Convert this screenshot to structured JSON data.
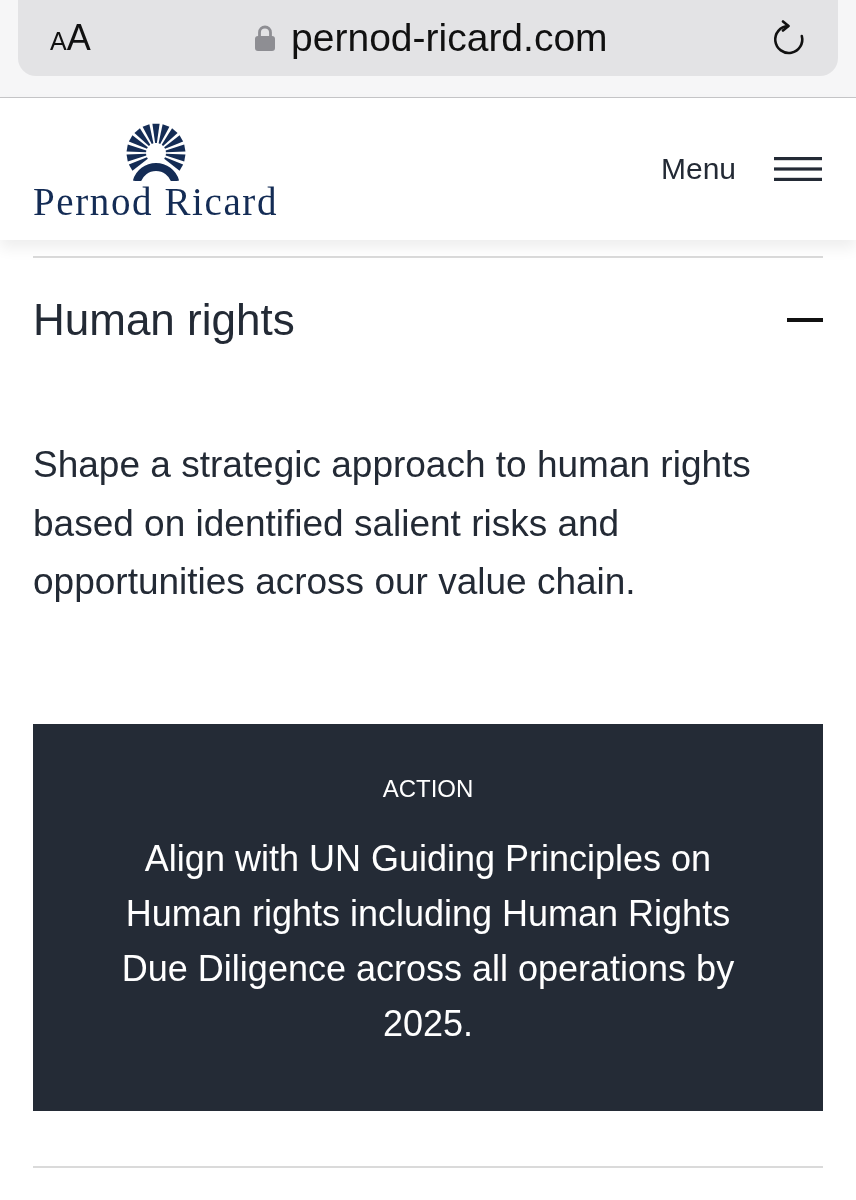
{
  "browser_bar": {
    "text_size_button": "AA",
    "secure": true,
    "url": "pernod-ricard.com"
  },
  "header": {
    "logo_text": "Pernod Ricard",
    "menu_label": "Menu"
  },
  "accordion": {
    "title": "Human rights",
    "expanded": true,
    "description": "Shape a strategic approach to human rights based on identified salient risks and opportunities across our value chain.",
    "action": {
      "label": "ACTION",
      "text": "Align with UN Guiding Principles on Human rights including Human Rights Due Diligence across all operations by 2025."
    }
  }
}
